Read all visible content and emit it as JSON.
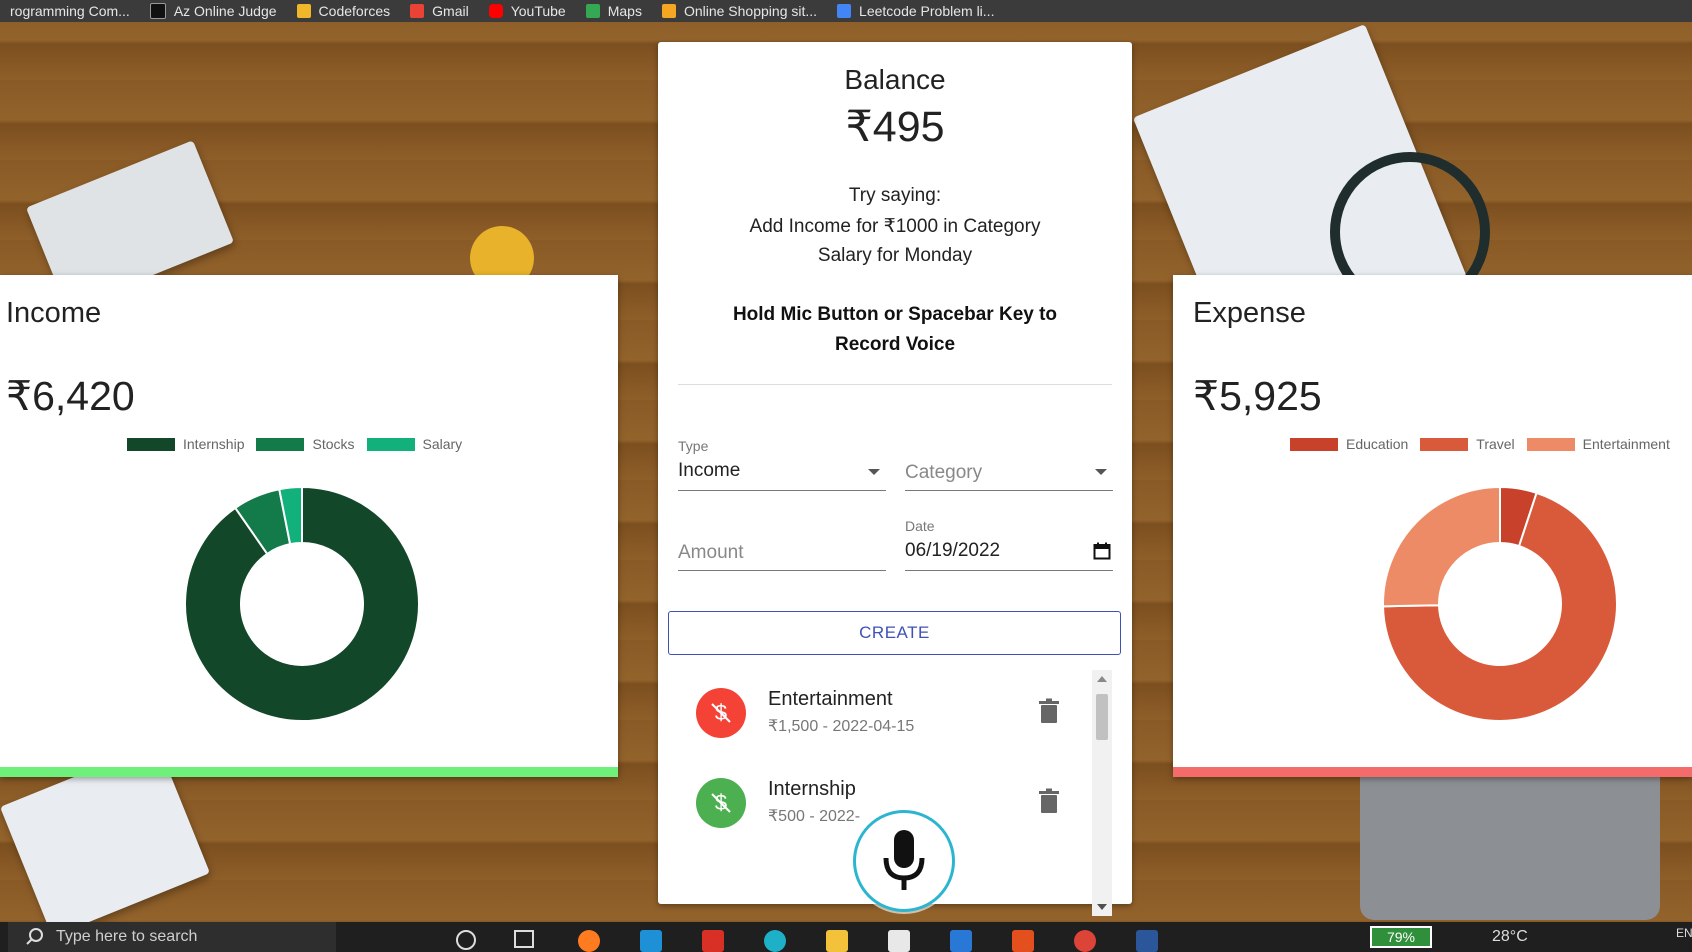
{
  "bookmarks": [
    {
      "label": "rogramming Com...",
      "color": "#ffffff"
    },
    {
      "label": "Az Online Judge",
      "color": "#111111"
    },
    {
      "label": "Codeforces",
      "color": "#f2b62b"
    },
    {
      "label": "Gmail",
      "color": "#ea4335"
    },
    {
      "label": "YouTube",
      "color": "#ff0000"
    },
    {
      "label": "Maps",
      "color": "#34a853"
    },
    {
      "label": "Online Shopping sit...",
      "color": "#f5a623"
    },
    {
      "label": "Leetcode Problem li...",
      "color": "#4285f4"
    }
  ],
  "balance": {
    "title": "Balance",
    "amount": "₹495",
    "hint_line1": "Try saying:",
    "hint_line2": "Add Income for ₹1000 in Category",
    "hint_line3": "Salary for Monday",
    "hold_text": "Hold Mic Button or Spacebar Key to Record Voice"
  },
  "form": {
    "type_label": "Type",
    "type_value": "Income",
    "category_placeholder": "Category",
    "amount_placeholder": "Amount",
    "date_label": "Date",
    "date_value": "06/19/2022",
    "create_label": "CREATE"
  },
  "transactions": [
    {
      "title": "Entertainment",
      "subtitle": "₹1,500 - 2022-04-15",
      "type": "expense",
      "color": "#f44336"
    },
    {
      "title": "Internship",
      "subtitle": "₹500 - 2022-",
      "type": "income",
      "color": "#4caf50"
    }
  ],
  "income": {
    "title": "Income",
    "amount": "₹6,420"
  },
  "expense": {
    "title": "Expense",
    "amount": "₹5,925"
  },
  "chart_data": [
    {
      "type": "pie",
      "title": "Income",
      "categories": [
        "Internship",
        "Stocks",
        "Salary"
      ],
      "values": [
        5800,
        420,
        200
      ],
      "colors": [
        "#12472a",
        "#137a4a",
        "#12b07a"
      ],
      "legend": "top"
    },
    {
      "type": "pie",
      "title": "Expense",
      "categories": [
        "Education",
        "Travel",
        "Entertainment"
      ],
      "values": [
        300,
        4125,
        1500
      ],
      "colors": [
        "#c8412b",
        "#d95a3a",
        "#ec8b66"
      ],
      "legend": "top"
    }
  ],
  "taskbar": {
    "search_placeholder": "Type here to search",
    "battery": "79%",
    "weather": "28°C",
    "lang": "EN"
  }
}
